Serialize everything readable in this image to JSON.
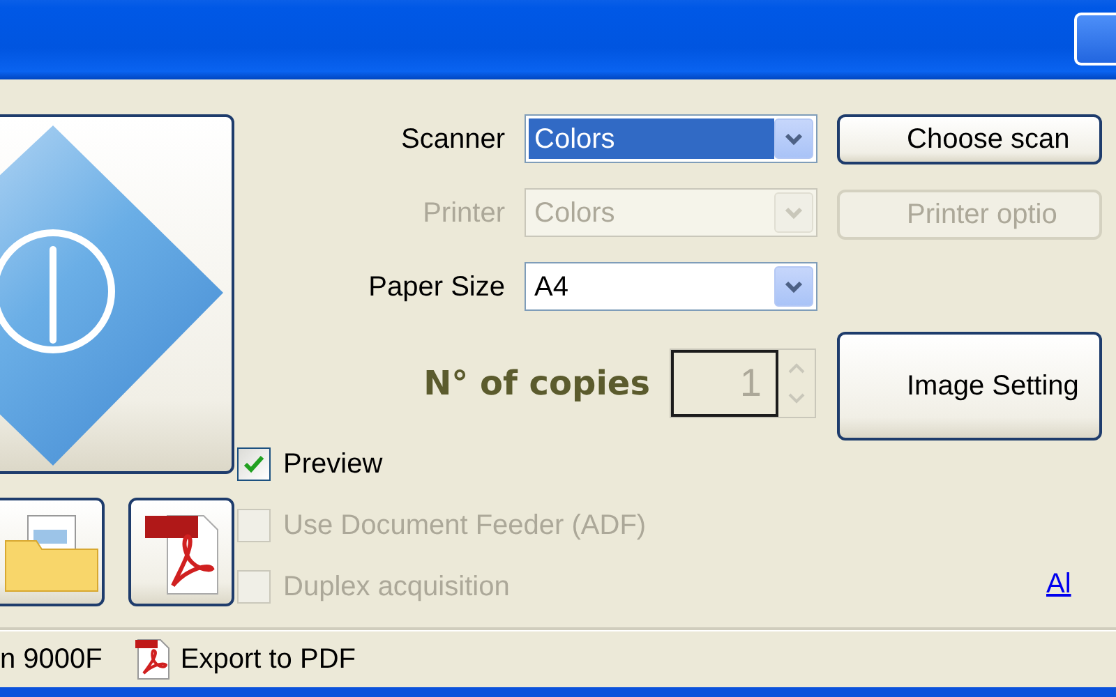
{
  "fields": [
    {
      "label": "Scanner",
      "value": "Colors",
      "disabled": false,
      "highlighted": true
    },
    {
      "label": "Printer",
      "value": "Colors",
      "disabled": true,
      "highlighted": false
    },
    {
      "label": "Paper Size",
      "value": "A4",
      "disabled": false,
      "highlighted": false
    }
  ],
  "copies": {
    "label": "N° of copies",
    "value": "1",
    "disabled": true
  },
  "checkboxes": [
    {
      "label": "Preview",
      "checked": true,
      "disabled": false
    },
    {
      "label": "Use Document Feeder (ADF)",
      "checked": false,
      "disabled": true
    },
    {
      "label": "Duplex acquisition",
      "checked": false,
      "disabled": true
    }
  ],
  "side_buttons": [
    {
      "label": "Choose scan",
      "disabled": false
    },
    {
      "label": "Printer optio",
      "disabled": true
    }
  ],
  "image_button": {
    "label": "Image Setting"
  },
  "link": "Al",
  "status_bar": [
    {
      "kind": "text",
      "text": "n 9000F"
    },
    {
      "kind": "pdf",
      "text": "Export to PDF"
    }
  ]
}
